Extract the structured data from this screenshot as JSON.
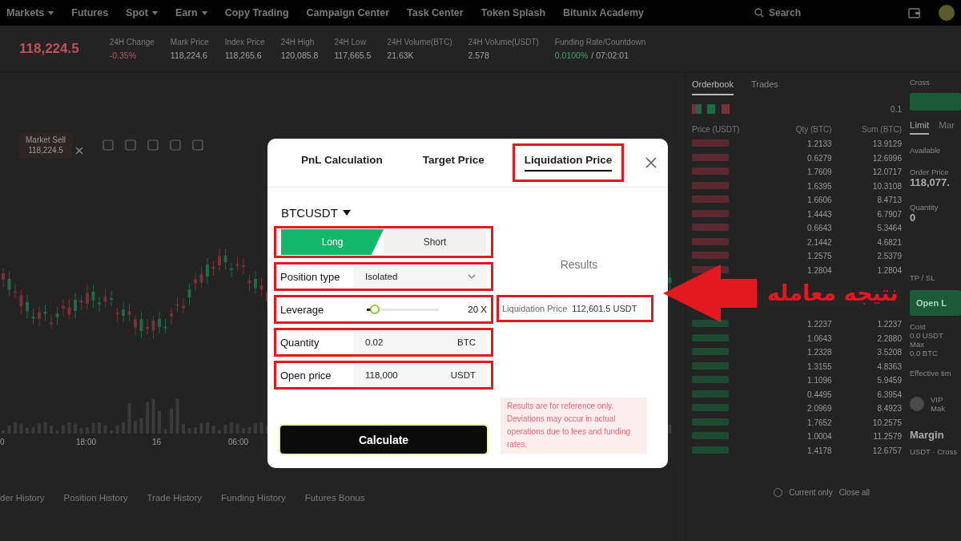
{
  "nav": {
    "items": [
      {
        "label": "Markets",
        "dropdown": true
      },
      {
        "label": "Futures",
        "dropdown": false
      },
      {
        "label": "Spot",
        "dropdown": true
      },
      {
        "label": "Earn",
        "dropdown": true
      },
      {
        "label": "Copy Trading",
        "dropdown": false
      },
      {
        "label": "Campaign Center",
        "dropdown": false
      },
      {
        "label": "Task Center",
        "dropdown": false
      },
      {
        "label": "Token Splash",
        "dropdown": false
      },
      {
        "label": "Bitunix Academy",
        "dropdown": false
      }
    ],
    "search": {
      "placeholder": "Search"
    }
  },
  "ticker": {
    "last_price": "118,224.5",
    "stats": [
      {
        "label": "24H Change",
        "value": "-0.35%",
        "kind": "down"
      },
      {
        "label": "Mark Price",
        "value": "118,224.6",
        "kind": "plain"
      },
      {
        "label": "Index Price",
        "value": "118,265.6",
        "kind": "plain"
      },
      {
        "label": "24H High",
        "value": "120,085.8",
        "kind": "plain"
      },
      {
        "label": "24H Low",
        "value": "117,665.5",
        "kind": "plain"
      },
      {
        "label": "24H Volume(BTC)",
        "value": "21.63K",
        "kind": "plain"
      },
      {
        "label": "24H Volume(USDT)",
        "value": "2.578",
        "kind": "plain"
      }
    ],
    "funding": {
      "label": "Funding Rate/Countdown",
      "rate": "0.0100%",
      "countdown": "/ 07:02:01"
    }
  },
  "chart": {
    "toast": {
      "title": "Market Sell",
      "price": "118,224.5"
    },
    "time_labels": [
      "0",
      "18:00",
      "16",
      "06:00"
    ]
  },
  "bottom_tabs": [
    "der History",
    "Position History",
    "Trade History",
    "Funding History",
    "Futures Bonus"
  ],
  "positions": {
    "filter": "Current only",
    "checked": false,
    "close_all": "Close all"
  },
  "orderbook": {
    "tabs": [
      {
        "label": "Orderbook",
        "selected": true
      },
      {
        "label": "Trades",
        "selected": false
      }
    ],
    "precision": "0.1",
    "columns": [
      "Price (USDT)",
      "Qty (BTC)",
      "Sum (BTC)"
    ],
    "asks": [
      {
        "qty": "1.2133",
        "sum": "13.9129"
      },
      {
        "qty": "0.6279",
        "sum": "12.6996"
      },
      {
        "qty": "1.7609",
        "sum": "12.0717"
      },
      {
        "qty": "1.6395",
        "sum": "10.3108"
      },
      {
        "qty": "1.6606",
        "sum": "8.4713"
      },
      {
        "qty": "1.4443",
        "sum": "6.7907"
      },
      {
        "qty": "0.6643",
        "sum": "5.3464"
      },
      {
        "qty": "2.1442",
        "sum": "4.6821"
      },
      {
        "qty": "1.2575",
        "sum": "2.5379"
      },
      {
        "qty": "1.2804",
        "sum": "1.2804"
      }
    ],
    "bids": [
      {
        "qty": "1.2237",
        "sum": "1.2237"
      },
      {
        "qty": "1.0643",
        "sum": "2.2880"
      },
      {
        "qty": "1.2328",
        "sum": "3.5208"
      },
      {
        "qty": "1.3155",
        "sum": "4.8363"
      },
      {
        "qty": "1.1096",
        "sum": "5.9459"
      },
      {
        "qty": "0.4495",
        "sum": "6.3954"
      },
      {
        "qty": "2.0969",
        "sum": "8.4923"
      },
      {
        "qty": "1.7652",
        "sum": "10.2575"
      },
      {
        "qty": "1.0004",
        "sum": "11.2579"
      },
      {
        "qty": "1.4178",
        "sum": "12.6757"
      }
    ]
  },
  "trade_panel": {
    "margin_mode": "Cross",
    "order_tabs": [
      {
        "label": "Limit",
        "selected": true
      },
      {
        "label": "Mar",
        "selected": false
      }
    ],
    "available": "Available",
    "order_price_label": "Order Price",
    "order_price": "118,077.",
    "quantity_label": "Quantity",
    "quantity": "0",
    "tpsl": "TP / SL",
    "open_button": "Open L",
    "cost_label": "Cost",
    "cost": "0.0 USDT",
    "max_label": "Max",
    "max": "0.0 BTC",
    "effective": "Effective tim",
    "vip": "VIP",
    "vip_sub": "Mak",
    "margin_title": "Margin",
    "margin_value": "USDT · Cross"
  },
  "modal": {
    "tabs": [
      {
        "label": "PnL Calculation",
        "selected": false,
        "highlighted": false
      },
      {
        "label": "Target Price",
        "selected": false,
        "highlighted": false
      },
      {
        "label": "Liquidation Price",
        "selected": true,
        "highlighted": true
      }
    ],
    "symbol": "BTCUSDT",
    "side": {
      "highlighted": true,
      "options": [
        {
          "label": "Long",
          "selected": true
        },
        {
          "label": "Short",
          "selected": false
        }
      ]
    },
    "fields": [
      {
        "kind": "select",
        "label": "Position type",
        "value": "Isolated",
        "highlighted": true
      },
      {
        "kind": "slider",
        "label": "Leverage",
        "level": 0.05,
        "value": "20 X",
        "highlighted": true
      },
      {
        "kind": "input",
        "label": "Quantity",
        "value": "0.02",
        "unit": "BTC",
        "highlighted": true
      },
      {
        "kind": "input",
        "label": "Open price",
        "value": "118,000",
        "unit": "USDT",
        "highlighted": true
      }
    ],
    "calculate": "Calculate",
    "results_title": "Results",
    "result": {
      "label": "Liquidation Price",
      "value": "112,601.5 USDT",
      "highlighted": true
    },
    "disclaimer": "Results are for reference only. Deviations may occur in actual operations due to fees and funding rates."
  },
  "callout": {
    "text": "نتیجه معامله"
  }
}
